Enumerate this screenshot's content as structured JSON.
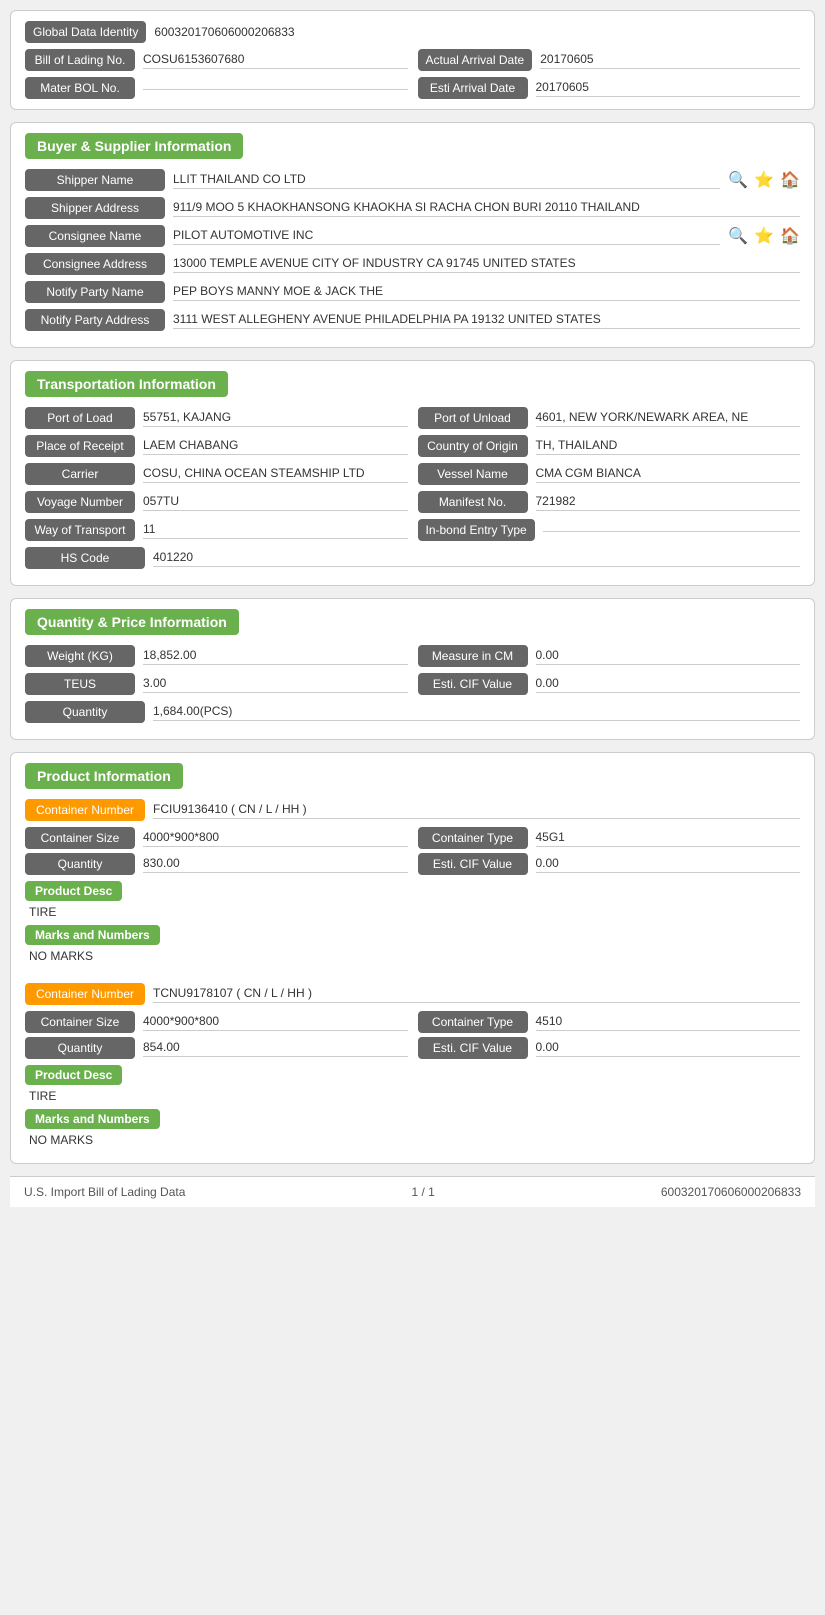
{
  "identity": {
    "global_label": "Global Data Identity",
    "global_value": "600320170606000206833",
    "bol_label": "Bill of Lading No.",
    "bol_value": "COSU6153607680",
    "arrival_actual_label": "Actual Arrival Date",
    "arrival_actual_value": "20170605",
    "master_label": "Mater BOL No.",
    "master_value": "",
    "arrival_esti_label": "Esti Arrival Date",
    "arrival_esti_value": "20170605"
  },
  "buyer_supplier": {
    "section_title": "Buyer & Supplier Information",
    "shipper_name_label": "Shipper Name",
    "shipper_name_value": "LLIT THAILAND CO LTD",
    "shipper_addr_label": "Shipper Address",
    "shipper_addr_value": "911/9 MOO 5 KHAOKHANSONG KHAOKHA SI RACHA CHON BURI 20110 THAILAND",
    "consignee_name_label": "Consignee Name",
    "consignee_name_value": "PILOT AUTOMOTIVE INC",
    "consignee_addr_label": "Consignee Address",
    "consignee_addr_value": "13000 TEMPLE AVENUE CITY OF INDUSTRY CA 91745 UNITED STATES",
    "notify_name_label": "Notify Party Name",
    "notify_name_value": "PEP BOYS MANNY MOE & JACK THE",
    "notify_addr_label": "Notify Party Address",
    "notify_addr_value": "3111 WEST ALLEGHENY AVENUE PHILADELPHIA PA 19132 UNITED STATES"
  },
  "transportation": {
    "section_title": "Transportation Information",
    "port_load_label": "Port of Load",
    "port_load_value": "55751, KAJANG",
    "port_unload_label": "Port of Unload",
    "port_unload_value": "4601, NEW YORK/NEWARK AREA, NE",
    "place_receipt_label": "Place of Receipt",
    "place_receipt_value": "LAEM CHABANG",
    "country_origin_label": "Country of Origin",
    "country_origin_value": "TH, THAILAND",
    "carrier_label": "Carrier",
    "carrier_value": "COSU, CHINA OCEAN STEAMSHIP LTD",
    "vessel_label": "Vessel Name",
    "vessel_value": "CMA CGM BIANCA",
    "voyage_label": "Voyage Number",
    "voyage_value": "057TU",
    "manifest_label": "Manifest No.",
    "manifest_value": "721982",
    "way_transport_label": "Way of Transport",
    "way_transport_value": "11",
    "inbond_label": "In-bond Entry Type",
    "inbond_value": "",
    "hs_label": "HS Code",
    "hs_value": "401220"
  },
  "quantity_price": {
    "section_title": "Quantity & Price Information",
    "weight_label": "Weight (KG)",
    "weight_value": "18,852.00",
    "measure_label": "Measure in CM",
    "measure_value": "0.00",
    "teus_label": "TEUS",
    "teus_value": "3.00",
    "esti_cif_label": "Esti. CIF Value",
    "esti_cif_value": "0.00",
    "quantity_label": "Quantity",
    "quantity_value": "1,684.00(PCS)"
  },
  "product_info": {
    "section_title": "Product Information",
    "containers": [
      {
        "number_label": "Container Number",
        "number_value": "FCIU9136410 ( CN / L / HH )",
        "size_label": "Container Size",
        "size_value": "4000*900*800",
        "type_label": "Container Type",
        "type_value": "45G1",
        "qty_label": "Quantity",
        "qty_value": "830.00",
        "cif_label": "Esti. CIF Value",
        "cif_value": "0.00",
        "desc_label": "Product Desc",
        "desc_value": "TIRE",
        "marks_label": "Marks and Numbers",
        "marks_value": "NO MARKS"
      },
      {
        "number_label": "Container Number",
        "number_value": "TCNU9178107 ( CN / L / HH )",
        "size_label": "Container Size",
        "size_value": "4000*900*800",
        "type_label": "Container Type",
        "type_value": "4510",
        "qty_label": "Quantity",
        "qty_value": "854.00",
        "cif_label": "Esti. CIF Value",
        "cif_value": "0.00",
        "desc_label": "Product Desc",
        "desc_value": "TIRE",
        "marks_label": "Marks and Numbers",
        "marks_value": "NO MARKS"
      }
    ]
  },
  "footer": {
    "left": "U.S. Import Bill of Lading Data",
    "center": "1 / 1",
    "right": "600320170606000206833"
  },
  "icons": {
    "search": "🔍",
    "star": "⭐",
    "home": "🏠"
  }
}
